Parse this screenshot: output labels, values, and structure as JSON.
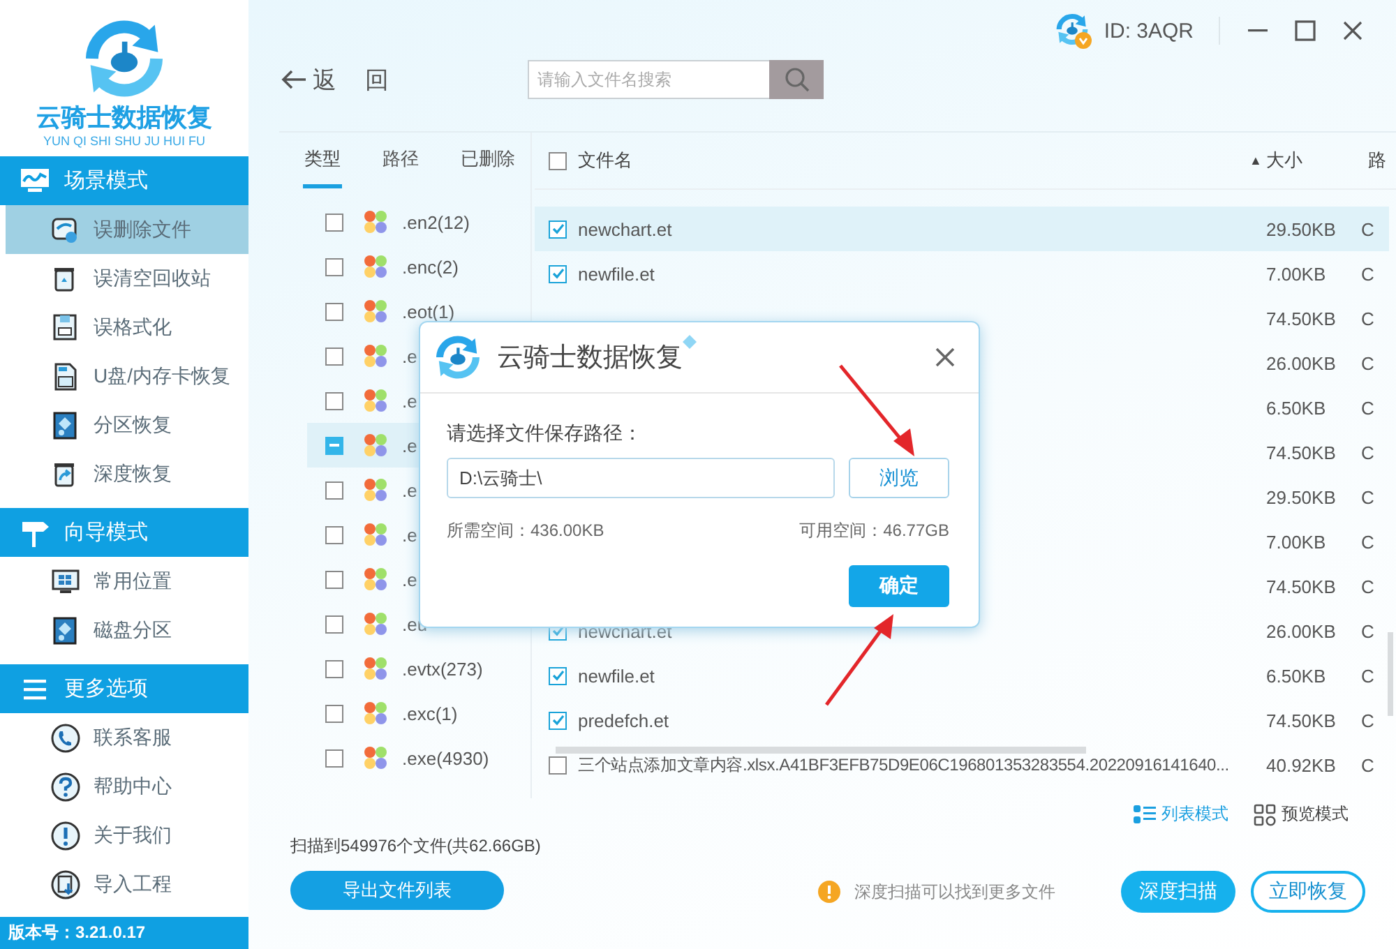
{
  "app": {
    "logo_title": "云骑士数据恢复",
    "logo_subtitle": "YUN QI SHI SHU JU HUI FU",
    "version": "版本号：3.21.0.17"
  },
  "sidebar": {
    "sections": [
      {
        "title": "场景模式",
        "items": [
          {
            "label": "误删除文件",
            "selected": true
          },
          {
            "label": "误清空回收站",
            "selected": false
          },
          {
            "label": "误格式化",
            "selected": false
          },
          {
            "label": "U盘/内存卡恢复",
            "selected": false
          },
          {
            "label": "分区恢复",
            "selected": false
          },
          {
            "label": "深度恢复",
            "selected": false
          }
        ]
      },
      {
        "title": "向导模式",
        "items": [
          {
            "label": "常用位置",
            "selected": false
          },
          {
            "label": "磁盘分区",
            "selected": false
          }
        ]
      },
      {
        "title": "更多选项",
        "items": [
          {
            "label": "联系客服",
            "selected": false
          },
          {
            "label": "帮助中心",
            "selected": false
          },
          {
            "label": "关于我们",
            "selected": false
          },
          {
            "label": "导入工程",
            "selected": false
          }
        ]
      }
    ]
  },
  "account": {
    "id": "ID: 3AQR"
  },
  "nav": {
    "back": "返 回"
  },
  "search": {
    "placeholder": "请输入文件名搜索"
  },
  "filter_tabs": [
    {
      "label": "类型",
      "selected": true
    },
    {
      "label": "路径",
      "selected": false
    },
    {
      "label": "已删除",
      "selected": false
    }
  ],
  "types": [
    {
      "label": ".en2(12)",
      "checked": false,
      "indeterminate": false,
      "selected": false
    },
    {
      "label": ".enc(2)",
      "checked": false,
      "indeterminate": false,
      "selected": false
    },
    {
      "label": ".eot(1)",
      "checked": false,
      "indeterminate": false,
      "selected": false
    },
    {
      "label": ".e",
      "checked": false,
      "indeterminate": false,
      "selected": false
    },
    {
      "label": ".e",
      "checked": false,
      "indeterminate": false,
      "selected": false
    },
    {
      "label": ".e",
      "indeterminate": true,
      "selected": true
    },
    {
      "label": ".e",
      "checked": false,
      "indeterminate": false,
      "selected": false
    },
    {
      "label": ".e",
      "checked": false,
      "indeterminate": false,
      "selected": false
    },
    {
      "label": ".e",
      "checked": false,
      "indeterminate": false,
      "selected": false
    },
    {
      "label": ".eu",
      "checked": false,
      "indeterminate": false,
      "selected": false
    },
    {
      "label": ".evtx(273)",
      "checked": false,
      "indeterminate": false,
      "selected": false
    },
    {
      "label": ".exc(1)",
      "checked": false,
      "indeterminate": false,
      "selected": false
    },
    {
      "label": ".exe(4930)",
      "checked": false,
      "indeterminate": false,
      "selected": false
    }
  ],
  "table": {
    "header_checked": false,
    "columns": [
      {
        "label": "文件名"
      },
      {
        "label": "大小",
        "sort_arrow": "▲"
      },
      {
        "label": "路"
      }
    ],
    "rows": [
      {
        "name": "newchart.et",
        "size": "29.50KB",
        "column_3": "C",
        "checked": true,
        "selected": true
      },
      {
        "name": "newfile.et",
        "size": "7.00KB",
        "column_3": "C",
        "checked": true,
        "selected": false
      },
      {
        "size": "74.50KB",
        "column_3": "C",
        "selected": false
      },
      {
        "size": "26.00KB",
        "column_3": "C",
        "selected": false
      },
      {
        "size": "6.50KB",
        "column_3": "C",
        "selected": false
      },
      {
        "size": "74.50KB",
        "column_3": "C",
        "selected": false
      },
      {
        "size": "29.50KB",
        "column_3": "C",
        "selected": false
      },
      {
        "size": "7.00KB",
        "column_3": "C",
        "selected": false
      },
      {
        "size": "74.50KB",
        "column_3": "C",
        "selected": false
      },
      {
        "name": "newchart.et",
        "size": "26.00KB",
        "column_3": "C",
        "checked": true,
        "selected": false
      },
      {
        "name": "newfile.et",
        "size": "6.50KB",
        "column_3": "C",
        "checked": true,
        "selected": false
      },
      {
        "name": "predefch.et",
        "size": "74.50KB",
        "column_3": "C",
        "checked": true,
        "selected": false
      },
      {
        "name": "三个站点添加文章内容.xlsx.A41BF3EFB75D9E06C196801353283554.20220916141640...",
        "size": "40.92KB",
        "column_3": "C",
        "checked": false,
        "selected": false
      }
    ]
  },
  "view_modes": [
    {
      "label": "列表模式",
      "selected": true
    },
    {
      "label": "预览模式",
      "selected": false
    }
  ],
  "status": {
    "count": "扫描到549976个文件(共62.66GB)",
    "export": "导出文件列表",
    "hint": "深度扫描可以找到更多文件"
  },
  "actions": [
    {
      "label": "深度扫描",
      "kind": "primary"
    },
    {
      "label": "立即恢复",
      "kind": "outline"
    }
  ],
  "dialog": {
    "title": "云骑士数据恢复",
    "prompt": "请选择文件保存路径：",
    "path": "D:\\云骑士\\",
    "browse": "浏览",
    "required": "所需空间：436.00KB",
    "available": "可用空间：46.77GB",
    "confirm": "确定"
  }
}
